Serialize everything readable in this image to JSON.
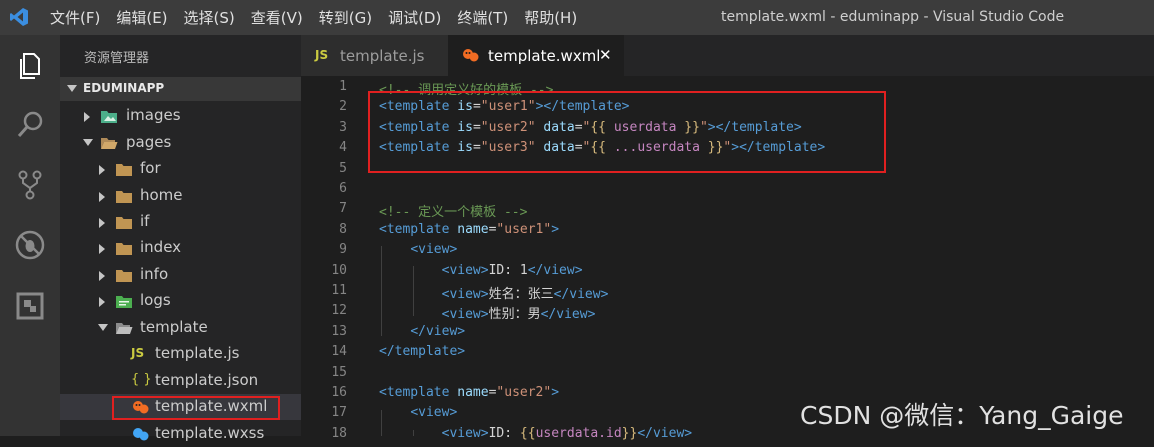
{
  "titlebar": {
    "menu": [
      "文件(F)",
      "编辑(E)",
      "选择(S)",
      "查看(V)",
      "转到(G)",
      "调试(D)",
      "终端(T)",
      "帮助(H)"
    ],
    "window_title": "template.wxml - eduminapp - Visual Studio Code"
  },
  "activity_bar": {
    "icons": [
      "explorer-icon",
      "search-icon",
      "source-control-icon",
      "debug-icon",
      "extensions-icon"
    ]
  },
  "sidebar": {
    "title": "资源管理器",
    "section": "EDUMINAPP",
    "items": [
      {
        "label": "images",
        "icon": "image-folder-icon",
        "expanded": false
      },
      {
        "label": "pages",
        "icon": "folder-open-icon",
        "expanded": true
      },
      {
        "label": "for",
        "icon": "folder-icon",
        "expanded": false
      },
      {
        "label": "home",
        "icon": "folder-icon",
        "expanded": false
      },
      {
        "label": "if",
        "icon": "folder-icon",
        "expanded": false
      },
      {
        "label": "index",
        "icon": "folder-icon",
        "expanded": false
      },
      {
        "label": "info",
        "icon": "folder-icon",
        "expanded": false
      },
      {
        "label": "logs",
        "icon": "logs-folder-icon",
        "expanded": false
      },
      {
        "label": "template",
        "icon": "folder-open-icon",
        "expanded": true
      },
      {
        "label": "template.js",
        "icon": "js-file-icon",
        "badge": "JS"
      },
      {
        "label": "template.json",
        "icon": "json-file-icon",
        "badge": "{ }"
      },
      {
        "label": "template.wxml",
        "icon": "wxml-file-icon"
      },
      {
        "label": "template.wxss",
        "icon": "wxss-file-icon"
      }
    ]
  },
  "tabs": [
    {
      "label": "template.js",
      "badge": "JS",
      "active": false
    },
    {
      "label": "template.wxml",
      "active": true,
      "close": "✕"
    }
  ],
  "editor": {
    "line_numbers": [
      "1",
      "2",
      "3",
      "4",
      "5",
      "6",
      "7",
      "8",
      "9",
      "10",
      "11",
      "12",
      "13",
      "14",
      "15",
      "16",
      "17",
      "18"
    ]
  },
  "watermark": "CSDN @微信：Yang_Gaige",
  "colors": {
    "titlebar": "#3c3c3c",
    "activity_bar": "#333333",
    "sidebar": "#252526",
    "editor_bg": "#1e1e1e",
    "highlight_box": "#e02020",
    "tag": "#569cd6",
    "attribute": "#9cdcfe",
    "string": "#ce9178",
    "comment": "#6a9955"
  }
}
